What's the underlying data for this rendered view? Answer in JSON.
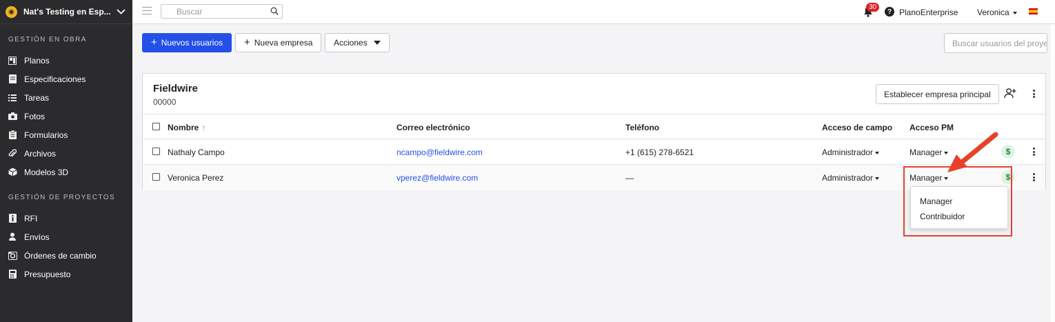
{
  "sidebar": {
    "project_name": "Nat's Testing en Esp...",
    "sections": [
      {
        "title": "GESTIÓN EN OBRA",
        "items": [
          {
            "label": "Planos",
            "icon": "plans-icon"
          },
          {
            "label": "Especificaciones",
            "icon": "specifications-icon"
          },
          {
            "label": "Tareas",
            "icon": "tasks-list-icon"
          },
          {
            "label": "Fotos",
            "icon": "camera-icon"
          },
          {
            "label": "Formularios",
            "icon": "clipboard-icon"
          },
          {
            "label": "Archivos",
            "icon": "paperclip-icon"
          },
          {
            "label": "Modelos 3D",
            "icon": "cube-icon"
          }
        ]
      },
      {
        "title": "GESTIÓN DE PROYECTOS",
        "items": [
          {
            "label": "RFI",
            "icon": "rfi-document-icon"
          },
          {
            "label": "Envíos",
            "icon": "submittals-icon"
          },
          {
            "label": "Órdenes de cambio",
            "icon": "change-orders-icon"
          },
          {
            "label": "Presupuesto",
            "icon": "calculator-icon"
          }
        ]
      }
    ]
  },
  "topbar": {
    "search_placeholder": "Buscar",
    "notification_count": "30",
    "help_label": "?",
    "plan": "PlanoEnterprise",
    "user": "Veronica"
  },
  "toolbar": {
    "new_users": "Nuevos usuarios",
    "new_company": "Nueva empresa",
    "actions": "Acciones",
    "user_search_placeholder": "Buscar usuarios del proyecto"
  },
  "company": {
    "name": "Fieldwire",
    "code": "00000",
    "set_main_label": "Establecer empresa principal"
  },
  "table": {
    "headers": {
      "name": "Nombre",
      "sort_arrow": "↑",
      "email": "Correo electrónico",
      "phone": "Teléfono",
      "field_access": "Acceso de campo",
      "pm_access": "Acceso PM"
    },
    "rows": [
      {
        "name": "Nathaly Campo",
        "email": "ncampo@fieldwire.com",
        "phone": "+1 (615) 278-6521",
        "field_access": "Administrador",
        "pm_access": "Manager"
      },
      {
        "name": "Veronica Perez",
        "email": "vperez@fieldwire.com",
        "phone": "—",
        "field_access": "Administrador",
        "pm_access": "Manager"
      }
    ]
  },
  "pm_dropdown": {
    "options": [
      "Manager",
      "Contribuidor"
    ]
  },
  "colors": {
    "sidebar_bg": "#2b2b2d",
    "primary_button": "#2450e8",
    "link": "#2450e8",
    "annotation": "#e8402a",
    "dollar_badge": "#1f8a3d"
  }
}
